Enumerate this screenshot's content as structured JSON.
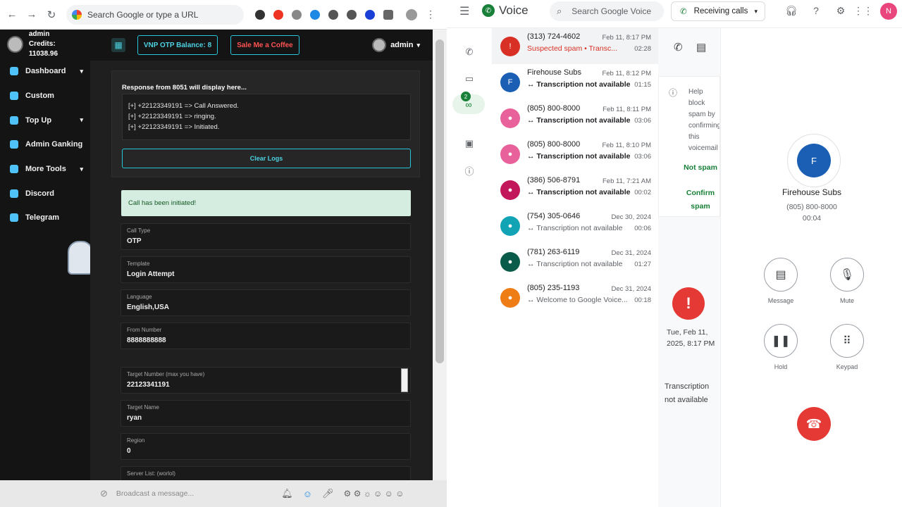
{
  "browser": {
    "search_placeholder": "Search Google or type a URL"
  },
  "app": {
    "user_name": "admin",
    "credits": "Credits: 11038.96",
    "nav": [
      {
        "label": "Dashboard",
        "chev": "▾"
      },
      {
        "label": "Custom",
        "chev": ""
      },
      {
        "label": "Top Up",
        "chev": "▾"
      },
      {
        "label": "Admin Ganking",
        "chev": ""
      },
      {
        "label": "More Tools",
        "chev": "▾"
      },
      {
        "label": "Discord",
        "chev": ""
      },
      {
        "label": "Telegram",
        "chev": ""
      }
    ],
    "balance_button": "VNP OTP Balance: 8",
    "coffee_button": "Sale Me a Coffee",
    "header_user": "admin",
    "response_title": "Response from 8051 will display here...",
    "logs": [
      "[+] +22123349191 => Call Answered.",
      "[+] +22123349191 => ringing.",
      "[+] +22123349191 => Initiated."
    ],
    "clear_logs": "Clear Logs",
    "alert": "Call has been initiated!",
    "fields": [
      {
        "label": "Call Type",
        "value": "OTP"
      },
      {
        "label": "Template",
        "value": "Login Attempt"
      },
      {
        "label": "Language",
        "value": "English,USA"
      },
      {
        "label": "From Number",
        "value": "8888888888"
      },
      {
        "label": "Target Number (max you have)",
        "value": "22123341191"
      },
      {
        "label": "Target Name",
        "value": "ryan"
      },
      {
        "label": "Region",
        "value": "0"
      },
      {
        "label": "Server List: (worlol)",
        "value": ""
      }
    ],
    "broadcast_placeholder": "Broadcast a message..."
  },
  "voice": {
    "app_name": "Voice",
    "search_placeholder": "Search Google Voice",
    "receiving": "Receiving calls",
    "avatar_letter": "N",
    "badge_count": "2",
    "calls": [
      {
        "number": "(313) 724-4602",
        "date": "Feb 11, 8:17 PM",
        "sub": "Suspected spam • Transc...",
        "dur": "02:28",
        "color": "#d93025",
        "letter": "!"
      },
      {
        "number": "Firehouse Subs",
        "date": "Feb 11, 8:12 PM",
        "sub": "↔ Transcription not available",
        "dur": "01:15",
        "color": "#1a5fb4",
        "letter": "F"
      },
      {
        "number": "(805) 800-8000",
        "date": "Feb 11, 8:11 PM",
        "sub": "↔ Transcription not available",
        "dur": "03:06",
        "color": "#e8619a",
        "letter": "●"
      },
      {
        "number": "(805) 800-8000",
        "date": "Feb 11, 8:10 PM",
        "sub": "↔ Transcription not available",
        "dur": "03:06",
        "color": "#e8619a",
        "letter": "●"
      },
      {
        "number": "(386) 506-8791",
        "date": "Feb 11, 7:21 AM",
        "sub": "↔ Transcription not available",
        "dur": "00:02",
        "color": "#c2185b",
        "letter": "●"
      },
      {
        "number": "(754) 305-0646",
        "date": "Dec 30, 2024",
        "sub": "↔ Transcription not available",
        "dur": "00:06",
        "color": "#12a4b5",
        "letter": "●"
      },
      {
        "number": "(781) 263-6119",
        "date": "Dec 31, 2024",
        "sub": "↔ Transcription not available",
        "dur": "01:27",
        "color": "#0b5b4a",
        "letter": "●"
      },
      {
        "number": "(805) 235-1193",
        "date": "Dec 31, 2024",
        "sub": "↔ Welcome to Google Voice...",
        "dur": "00:18",
        "color": "#ef7d16",
        "letter": "●"
      }
    ],
    "help_text": "Help block spam by confirming this voicemail is spam",
    "not_spam": "Not spam",
    "confirm_spam": "Confirm spam",
    "detail_date": "Tue, Feb 11, 2025, 8:17 PM",
    "detail_transcription": "Transcription not available",
    "active": {
      "letter": "F",
      "name": "Firehouse Subs",
      "number": "(805) 800-8000",
      "timer": "00:04"
    },
    "controls": {
      "message": "Message",
      "mute": "Mute",
      "hold": "Hold",
      "keypad": "Keypad"
    }
  }
}
